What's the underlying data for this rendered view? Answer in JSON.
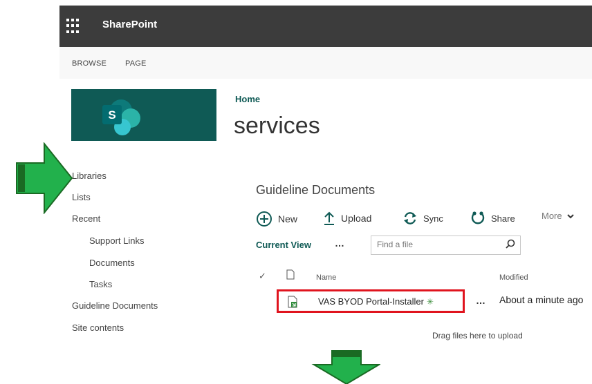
{
  "suitebar": {
    "brand": "SharePoint",
    "bg": "#3c3c3c"
  },
  "ribbon": {
    "tabs": [
      "BROWSE",
      "PAGE"
    ]
  },
  "breadcrumb": "Home",
  "site_title": "services",
  "nav": {
    "items": [
      "Libraries",
      "Lists",
      "Recent"
    ],
    "recent_children": [
      "Support Links",
      "Documents",
      "Tasks"
    ],
    "after": [
      "Guideline Documents",
      "Site contents"
    ]
  },
  "library": {
    "title": "Guideline Documents",
    "commands": {
      "new": "New",
      "upload": "Upload",
      "sync": "Sync",
      "share": "Share",
      "more": "More"
    },
    "current_view": "Current View",
    "view_options": "…",
    "search_placeholder": "Find a file",
    "columns": {
      "name": "Name",
      "modified": "Modified"
    },
    "rows": [
      {
        "name": "VAS BYOD Portal-Installer",
        "new_marker": "✳",
        "modified": "About a minute ago"
      }
    ],
    "drop_hint": "Drag files here to upload"
  },
  "colors": {
    "accent": "#0f5a55",
    "highlight": "#e0141e",
    "callout": "#22b14c"
  },
  "icons": {
    "new": "plus-circle-icon",
    "upload": "upload-arrow-icon",
    "sync": "sync-icon",
    "share": "share-icon"
  }
}
